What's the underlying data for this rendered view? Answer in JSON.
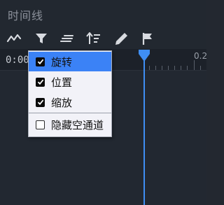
{
  "panel": {
    "title": "时间线"
  },
  "toolbar": {
    "tools": [
      {
        "icon": "waveform-icon"
      },
      {
        "icon": "filter-icon"
      },
      {
        "icon": "align-lines-icon"
      },
      {
        "icon": "sort-icon"
      },
      {
        "icon": "pen-icon"
      },
      {
        "icon": "flag-icon"
      }
    ]
  },
  "ruler": {
    "current_time": "0:00",
    "tick_label": "0.2"
  },
  "menu": {
    "items": [
      {
        "label": "旋转",
        "checked": true
      },
      {
        "label": "位置",
        "checked": true
      },
      {
        "label": "缩放",
        "checked": true
      },
      {
        "label": "隐藏空通道",
        "checked": false
      }
    ]
  },
  "colors": {
    "background": "#222830",
    "accent": "#3f8ef3",
    "menu_highlight": "#3b82f6",
    "menu_bg": "#f2f2f8"
  }
}
